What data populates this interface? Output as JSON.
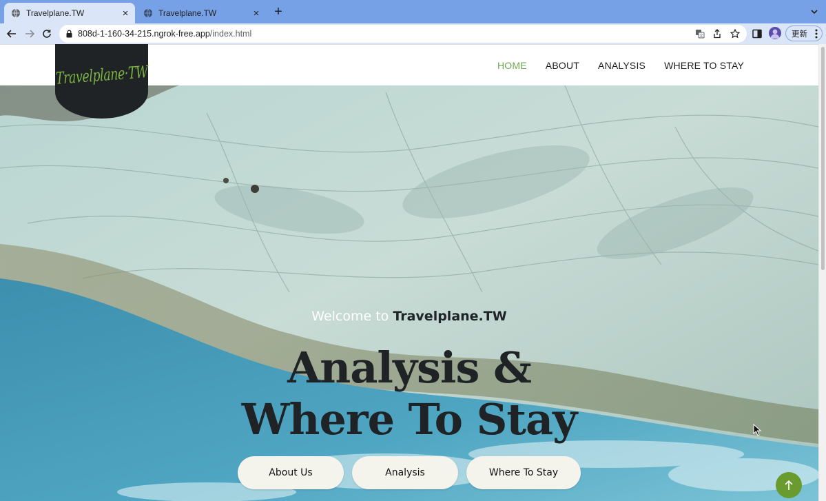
{
  "browser": {
    "tabs": [
      {
        "title": "Travelplane.TW",
        "active": true
      },
      {
        "title": "Travelplane.TW",
        "active": false
      }
    ],
    "url_host": "808d-1-160-34-215.ngrok-free.app",
    "url_path": "/index.html",
    "update_label": "更新",
    "colors": {
      "tabstrip": "#77a1e6",
      "toolbar": "#dbe5f8"
    },
    "icons": [
      "globe-icon",
      "close-icon",
      "plus-icon",
      "chevron-down-icon",
      "back-arrow-icon",
      "forward-arrow-icon",
      "reload-icon",
      "lock-icon",
      "translate-icon",
      "share-icon",
      "star-icon",
      "sidebar-icon",
      "profile-avatar",
      "kebab-menu-icon"
    ]
  },
  "site": {
    "logo_text": "Travelplane·TW",
    "nav": {
      "home": "HOME",
      "about": "ABOUT",
      "analysis": "ANALYSIS",
      "where_to_stay": "WHERE TO STAY"
    },
    "hero": {
      "welcome_prefix": "Welcome to",
      "welcome_brand": "Travelplane.TW",
      "headline_line1": "Analysis &",
      "headline_line2": "Where To Stay",
      "buttons": {
        "about": "About Us",
        "analysis": "Analysis",
        "stay": "Where To Stay"
      }
    },
    "colors": {
      "accent": "#6aa84f",
      "logo_bg": "#202326",
      "button_bg": "#f4f3ec"
    }
  }
}
